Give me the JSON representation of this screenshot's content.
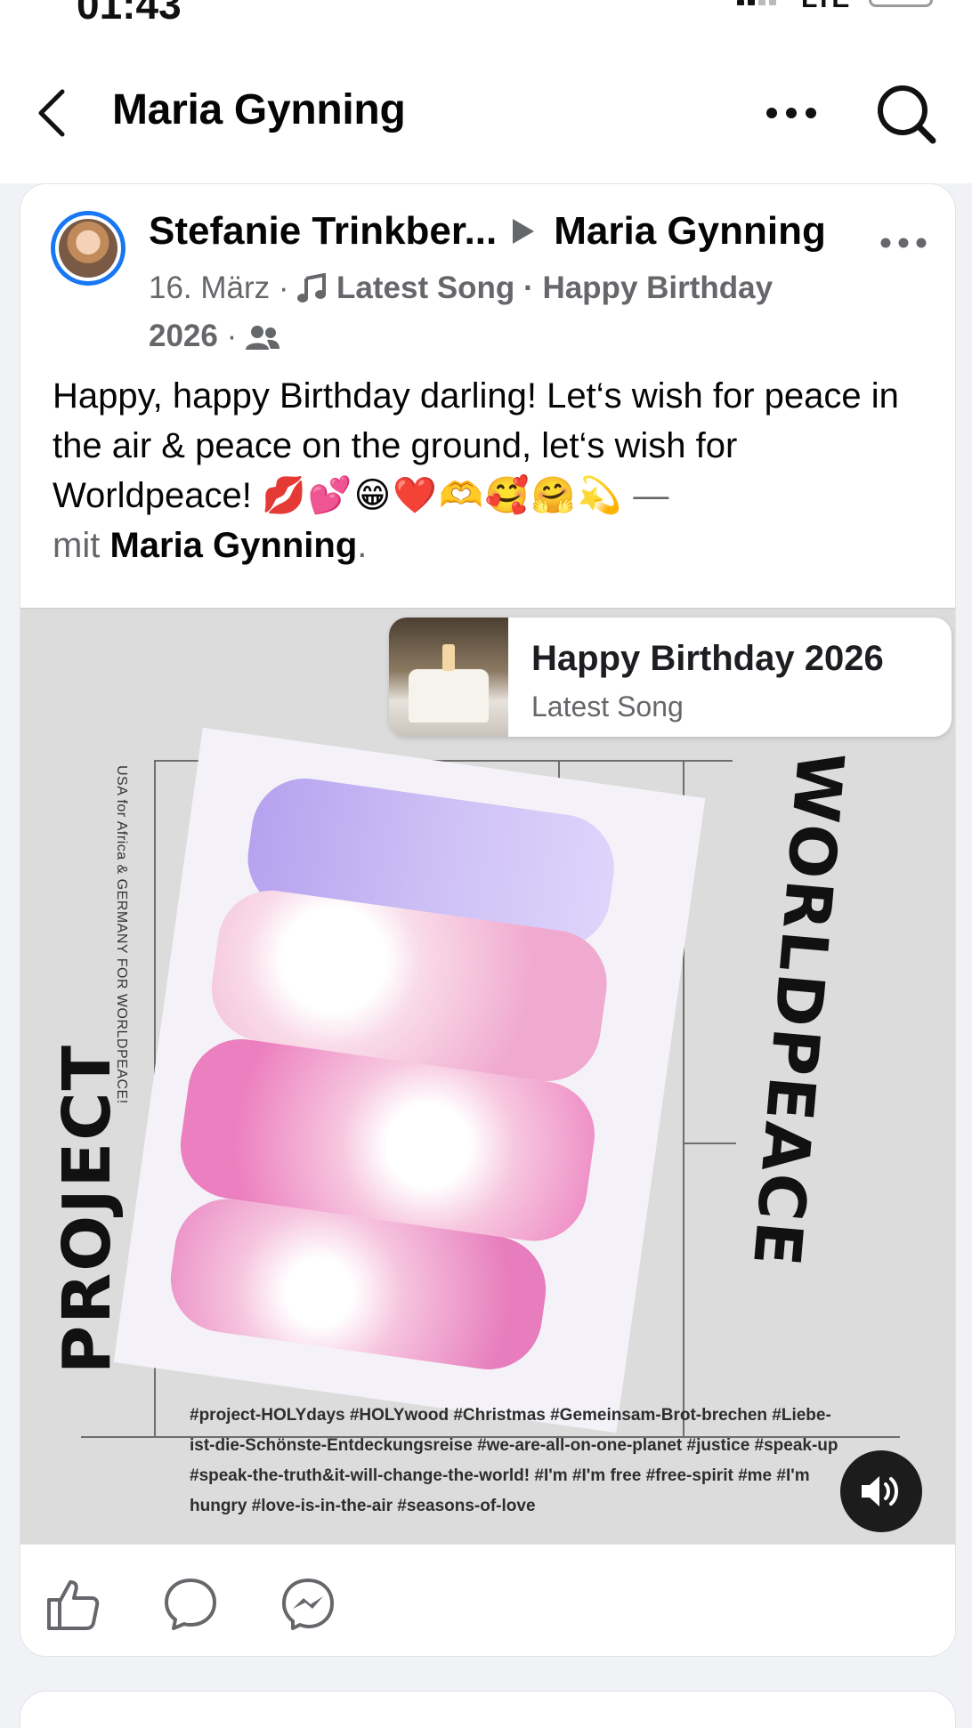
{
  "status_bar": {
    "time": "01:43",
    "network": "LTE"
  },
  "header": {
    "title": "Maria Gynning"
  },
  "post": {
    "author": "Stefanie Trinkber...",
    "target": "Maria Gynning",
    "date": "16. März",
    "separator": "·",
    "music_label": "Latest Song",
    "song_title_meta": "Happy Birthday",
    "song_year_meta": "2026",
    "text_main": "Happy, happy Birthday darling! Let‘s wish for peace in the air & peace on the ground, let‘s wish for Worldpeace! ",
    "emojis": "💋💕😁❤️🫶🥰🤗💫",
    "text_tail_dash": " —",
    "text_mit": "mit ",
    "tagged_person": "Maria Gynning",
    "text_end": ".",
    "media": {
      "song_card_title": "Happy Birthday 2026",
      "song_card_subtitle": "Latest Song",
      "cover_left_text": "USA for Africa & GERMANY FOR WORLDPEACE!",
      "cover_project": "PROJECT",
      "cover_worldpeace": "WORLDPEACE",
      "hashtags": "#project-HOLYdays #HOLYwood #Christmas #Gemeinsam-Brot-brechen #Liebe-ist-die-Schönste-Entdeckungsreise #we-are-all-on-one-planet #justice #speak-up #speak-the-truth&it-will-change-the-world! #I'm #I'm free #free-spirit #me #I'm hungry #love-is-in-the-air #seasons-of-love"
    }
  },
  "icons": {
    "back": "chevron-left-icon",
    "more": "more-dots-icon",
    "search": "search-icon",
    "like": "thumbs-up-icon",
    "comment": "comment-icon",
    "share": "messenger-icon",
    "volume": "volume-icon",
    "music": "music-note-icon",
    "audience": "friends-icon"
  },
  "colors": {
    "accent": "#1877f2",
    "muted": "#65676b",
    "background": "#f0f2f5"
  }
}
